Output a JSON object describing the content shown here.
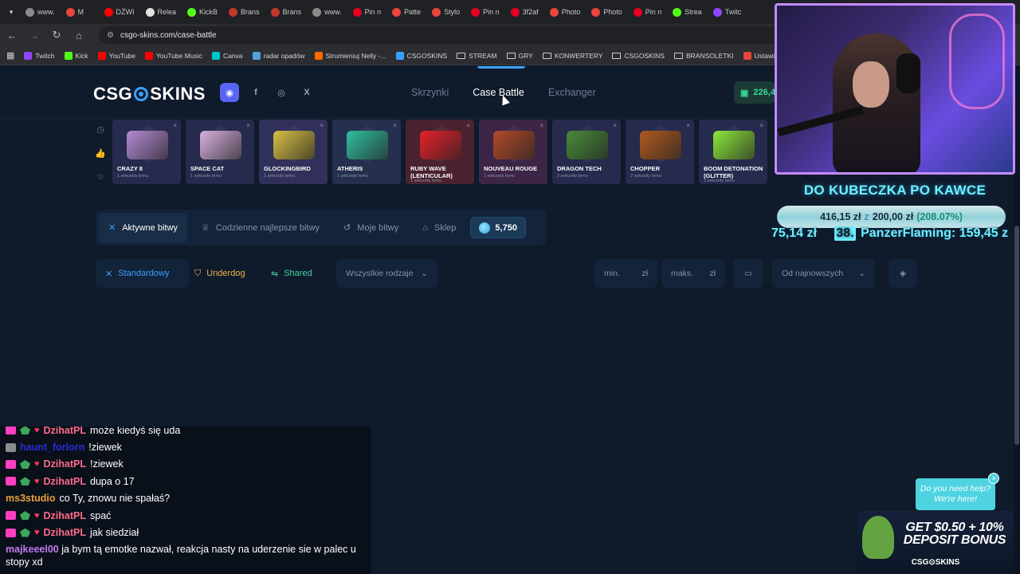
{
  "browser": {
    "tabs": [
      {
        "label": "www.",
        "color": "#8a8a8a"
      },
      {
        "label": "M",
        "color": "#e8453c"
      },
      {
        "label": "DŹWI",
        "color": "#ff0000"
      },
      {
        "label": "Relea",
        "color": "#e0e0e0"
      },
      {
        "label": "KickB",
        "color": "#53fc18"
      },
      {
        "label": "Brans",
        "color": "#c0392b"
      },
      {
        "label": "Brans",
        "color": "#c0392b"
      },
      {
        "label": "www.",
        "color": "#8a8a8a"
      },
      {
        "label": "Pin n",
        "color": "#e60023"
      },
      {
        "label": "Patte",
        "color": "#e8453c"
      },
      {
        "label": "Stylo",
        "color": "#e8453c"
      },
      {
        "label": "Pin n",
        "color": "#e60023"
      },
      {
        "label": "3f2af",
        "color": "#e60023"
      },
      {
        "label": "Photo",
        "color": "#e8453c"
      },
      {
        "label": "Photo",
        "color": "#e8453c"
      },
      {
        "label": "Pin n",
        "color": "#e60023"
      },
      {
        "label": "Strea",
        "color": "#53fc18"
      },
      {
        "label": "Twitc",
        "color": "#9146ff"
      }
    ],
    "url": "csgo-skins.com/case-battle",
    "bookmarks": [
      {
        "label": "Twitch",
        "color": "#9146ff",
        "type": "site"
      },
      {
        "label": "Kick",
        "color": "#53fc18",
        "type": "site"
      },
      {
        "label": "YouTube",
        "color": "#ff0000",
        "type": "site"
      },
      {
        "label": "YouTube Music",
        "color": "#ff0000",
        "type": "site"
      },
      {
        "label": "Canva",
        "color": "#00c4cc",
        "type": "site"
      },
      {
        "label": "radar opadów",
        "color": "#4fa3e0",
        "type": "site"
      },
      {
        "label": "Strumieniuj Nelly -...",
        "color": "#ff6a00",
        "type": "site"
      },
      {
        "label": "CSGOSKINS",
        "color": "#3aa0ff",
        "type": "site"
      },
      {
        "label": "STREAM",
        "type": "folder"
      },
      {
        "label": "GRY",
        "type": "folder"
      },
      {
        "label": "KONWERTERY",
        "type": "folder"
      },
      {
        "label": "CSGOSKINS",
        "type": "folder"
      },
      {
        "label": "BRANSOLETKI",
        "type": "folder"
      },
      {
        "label": "Ustawienia strumien...",
        "color": "#e8453c",
        "type": "site"
      }
    ]
  },
  "site": {
    "logo": {
      "left": "CSG",
      "right": "SKINS"
    },
    "nav": [
      "Skrzynki",
      "Case Battle",
      "Exchanger"
    ],
    "balance": "226,4"
  },
  "drops": [
    {
      "name": "CRAZY 8",
      "time": "1 sekundę temu",
      "bg": "#262a4d",
      "art": "#b58bd6"
    },
    {
      "name": "SPACE CAT",
      "time": "1 sekundę temu",
      "bg": "#262a4d",
      "art": "#d9b0e0"
    },
    {
      "name": "GLOCKINGBIRD",
      "time": "1 sekundę temu",
      "bg": "#30305a",
      "art": "#d9c043"
    },
    {
      "name": "ATHERIS",
      "time": "1 sekundę temu",
      "bg": "#25304f",
      "art": "#2fbfa0"
    },
    {
      "name": "RUBY WAVE (LENTICULAR)",
      "time": "1 sekundę temu",
      "bg": "#4a2230",
      "art": "#e8202a"
    },
    {
      "name": "NOUVEAU ROUGE",
      "time": "1 sekundę temu",
      "bg": "#3c2547",
      "art": "#b44a2a"
    },
    {
      "name": "DRAGON TECH",
      "time": "2 sekundy temu",
      "bg": "#262a4d",
      "art": "#4a8a3a"
    },
    {
      "name": "CHOPPER",
      "time": "2 sekundy temu",
      "bg": "#262a4d",
      "art": "#b05a20"
    },
    {
      "name": "BOOM DETONATION (GLITTER)",
      "time": "3 sekundy temu",
      "bg": "#262a4d",
      "art": "#8de83a"
    }
  ],
  "battle_tabs": [
    "Aktywne bitwy",
    "Codzienne najlepsze bitwy",
    "Moje bitwy",
    "Sklep"
  ],
  "coins": "5,750",
  "filters": {
    "modes": [
      "Standardowy",
      "Underdog",
      "Shared"
    ],
    "kind": "Wszystkie rodzaje",
    "min_placeholder": "min.",
    "max_placeholder": "maks.",
    "currency": "zł",
    "sort": "Od najnowszych"
  },
  "overlay": {
    "goal_title": "DO KUBECZKA PO KAWCE",
    "goal_current": "416,15 zł",
    "goal_sep": "z",
    "goal_target": "200,00 zł",
    "goal_pct": "(208.07%)",
    "ticker_amount": "75,14 zł",
    "ticker_rank": "38.",
    "ticker_name": "PanzerFlaming:",
    "ticker_value": "159,45 z"
  },
  "chat": [
    {
      "user": "DzihatPL",
      "msg": "może kiedyś się uda",
      "color": "#ff6b8b",
      "badges": [
        "pink",
        "leaf",
        "heart"
      ],
      "partial": true
    },
    {
      "user": "haunt_forlorn",
      "msg": "!ziewek",
      "color": "#2b2bd6",
      "badges": [
        "img"
      ]
    },
    {
      "user": "DzihatPL",
      "msg": "!ziewek",
      "color": "#ff6b8b",
      "badges": [
        "pink",
        "leaf",
        "heart"
      ]
    },
    {
      "user": "DzihatPL",
      "msg": "dupa o 17",
      "color": "#ff6b8b",
      "badges": [
        "pink",
        "leaf",
        "heart"
      ]
    },
    {
      "user": "ms3studio",
      "msg": "co Ty, znowu nie spałaś?",
      "color": "#e8a23a",
      "badges": []
    },
    {
      "user": "DzihatPL",
      "msg": "spać",
      "color": "#ff6b8b",
      "badges": [
        "pink",
        "leaf",
        "heart"
      ]
    },
    {
      "user": "DzihatPL",
      "msg": "jak siedział",
      "color": "#ff6b8b",
      "badges": [
        "pink",
        "leaf",
        "heart"
      ]
    },
    {
      "user": "majkeeel00",
      "msg": "ja bym tą emotke nazwał, reakcja nasty na uderzenie sie w palec u stopy xd",
      "color": "#c07af0",
      "badges": [],
      "wrap": true
    }
  ],
  "help": {
    "line1": "Do you need help?",
    "line2": "We're here!"
  },
  "promo": {
    "line1": "GET $0.50 + 10%",
    "line2": "DEPOSIT BONUS",
    "brand": "CSG⊙SKINS"
  }
}
